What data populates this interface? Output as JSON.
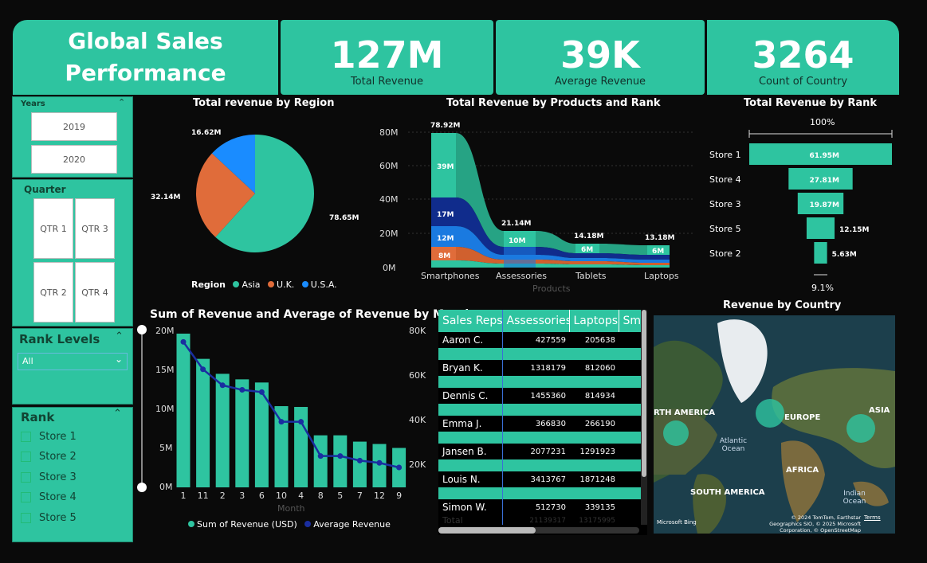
{
  "header": {
    "title_line1": "Global Sales",
    "title_line2": "Performance",
    "kpis": [
      {
        "value": "127M",
        "label": "Total Revenue"
      },
      {
        "value": "39K",
        "label": "Average Revenue"
      },
      {
        "value": "3264",
        "label": "Count of Country"
      }
    ]
  },
  "slicers": {
    "years": {
      "label": "Years",
      "options": [
        "2019",
        "2020"
      ]
    },
    "quarter": {
      "label": "Quarter",
      "options": [
        "QTR 1",
        "QTR 3",
        "QTR 2",
        "QTR 4"
      ]
    },
    "rank_levels": {
      "label": "Rank Levels",
      "value": "All"
    },
    "rank": {
      "label": "Rank",
      "options": [
        "Store 1",
        "Store 2",
        "Store 3",
        "Store 4",
        "Store 5"
      ]
    }
  },
  "pie": {
    "title": "Total revenue by Region",
    "legend_label": "Region",
    "slices": [
      {
        "name": "Asia",
        "value": 78.65,
        "label": "78.65M",
        "color": "#2ec4a0"
      },
      {
        "name": "U.K.",
        "value": 32.14,
        "label": "32.14M",
        "color": "#e06c3a"
      },
      {
        "name": "U.S.A.",
        "value": 16.62,
        "label": "16.62M",
        "color": "#1a8cff"
      }
    ]
  },
  "ribbon": {
    "title": "Total Revenue by Products and Rank",
    "xlabel": "Products",
    "yticks": [
      "80M",
      "60M",
      "40M",
      "20M",
      "0M"
    ],
    "categories": [
      "Smartphones",
      "Assessories",
      "Tablets",
      "Laptops"
    ],
    "totals": [
      "78.92M",
      "21.14M",
      "14.18M",
      "13.18M"
    ],
    "inner_labels": [
      [
        "39M",
        "17M",
        "12M",
        "8M"
      ],
      [
        "10M"
      ],
      [
        "6M"
      ],
      [
        "6M"
      ]
    ]
  },
  "funnel": {
    "title": "Total Revenue by Rank",
    "top_pct": "100%",
    "bottom_pct": "9.1%",
    "rows": [
      {
        "name": "Store 1",
        "value": 61.95,
        "label": "61.95M"
      },
      {
        "name": "Store 4",
        "value": 27.81,
        "label": "27.81M"
      },
      {
        "name": "Store 3",
        "value": 19.87,
        "label": "19.87M"
      },
      {
        "name": "Store 5",
        "value": 12.15,
        "label": "12.15M"
      },
      {
        "name": "Store 2",
        "value": 5.63,
        "label": "5.63M"
      }
    ]
  },
  "combo": {
    "title": "Sum of Revenue and Average of Revenue by Month",
    "xlabel": "Month",
    "yticks_left": [
      "20M",
      "15M",
      "10M",
      "5M",
      "0M"
    ],
    "yticks_right": [
      "80K",
      "60K",
      "40K",
      "20K"
    ],
    "legend_bar": "Sum of Revenue (USD)",
    "legend_line": "Average Revenue"
  },
  "chart_data": {
    "type": "bar",
    "categories": [
      "1",
      "11",
      "2",
      "3",
      "6",
      "10",
      "4",
      "8",
      "5",
      "7",
      "12",
      "9"
    ],
    "series": [
      {
        "name": "Sum of Revenue (USD)",
        "values": [
          19.5,
          16.3,
          14.4,
          13.7,
          13.3,
          10.3,
          10.2,
          6.6,
          6.6,
          5.8,
          5.5,
          5.0
        ]
      },
      {
        "name": "Average Revenue",
        "values": [
          75,
          63,
          56,
          54,
          53,
          40,
          40,
          25,
          25,
          23,
          22,
          20
        ]
      }
    ],
    "xlabel": "Month",
    "ylim": [
      0,
      20
    ],
    "y2lim": [
      10,
      80
    ]
  },
  "table": {
    "headers": [
      "Sales Reps",
      "Assessories",
      "Laptops",
      "Sm"
    ],
    "rows": [
      [
        "Aaron C.",
        "427559",
        "205638"
      ],
      [
        "Bryan K.",
        "1318179",
        "812060"
      ],
      [
        "Dennis C.",
        "1455360",
        "814934"
      ],
      [
        "Emma J.",
        "366830",
        "266190"
      ],
      [
        "Jansen B.",
        "2077231",
        "1291923"
      ],
      [
        "Louis N.",
        "3413767",
        "1871248"
      ],
      [
        "Simon W.",
        "512730",
        "339135"
      ]
    ],
    "total": [
      "Total",
      "21139317",
      "13175995"
    ]
  },
  "map": {
    "title": "Revenue by Country",
    "labels": [
      "RTH AMERICA",
      "EUROPE",
      "ASIA",
      "Atlantic Ocean",
      "AFRICA",
      "SOUTH AMERICA",
      "Indian Ocean"
    ],
    "copyright": "© 2024 TomTom, Earthstar Geographics SIO, © 2025 Microsoft Corporation, © OpenStreetMap",
    "terms": "Terms",
    "brand": "Microsoft Bing"
  }
}
